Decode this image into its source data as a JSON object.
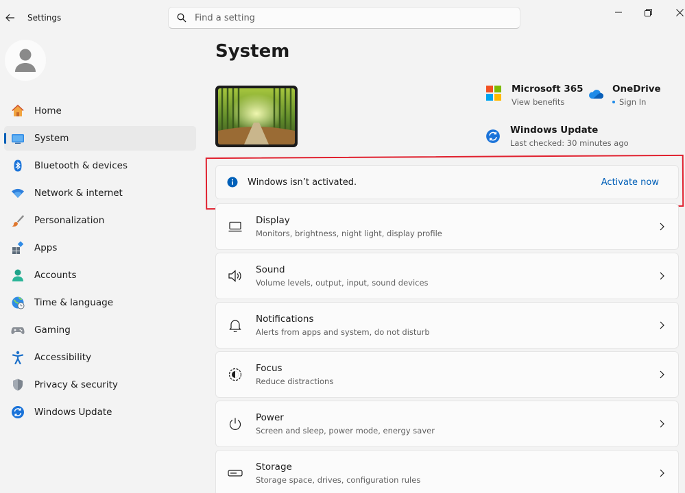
{
  "window": {
    "title": "Settings",
    "search_placeholder": "Find a setting"
  },
  "sidebar": {
    "items": [
      {
        "label": "Home",
        "icon": "home-icon",
        "selected": false
      },
      {
        "label": "System",
        "icon": "system-icon",
        "selected": true
      },
      {
        "label": "Bluetooth & devices",
        "icon": "bluetooth-icon",
        "selected": false
      },
      {
        "label": "Network & internet",
        "icon": "wifi-icon",
        "selected": false
      },
      {
        "label": "Personalization",
        "icon": "brush-icon",
        "selected": false
      },
      {
        "label": "Apps",
        "icon": "apps-icon",
        "selected": false
      },
      {
        "label": "Accounts",
        "icon": "accounts-icon",
        "selected": false
      },
      {
        "label": "Time & language",
        "icon": "globe-icon",
        "selected": false
      },
      {
        "label": "Gaming",
        "icon": "gamepad-icon",
        "selected": false
      },
      {
        "label": "Accessibility",
        "icon": "accessibility-icon",
        "selected": false
      },
      {
        "label": "Privacy & security",
        "icon": "shield-icon",
        "selected": false
      },
      {
        "label": "Windows Update",
        "icon": "update-icon",
        "selected": false
      }
    ]
  },
  "main": {
    "title": "System",
    "quick_links": {
      "m365": {
        "title": "Microsoft 365",
        "subtitle": "View benefits"
      },
      "onedrive": {
        "title": "OneDrive",
        "subtitle": "Sign In"
      },
      "windows_update": {
        "title": "Windows Update",
        "subtitle": "Last checked: 30 minutes ago"
      }
    },
    "activation": {
      "message": "Windows isn’t activated.",
      "action": "Activate now"
    },
    "cards": [
      {
        "title": "Display",
        "subtitle": "Monitors, brightness, night light, display profile",
        "icon": "display-icon"
      },
      {
        "title": "Sound",
        "subtitle": "Volume levels, output, input, sound devices",
        "icon": "speaker-icon"
      },
      {
        "title": "Notifications",
        "subtitle": "Alerts from apps and system, do not disturb",
        "icon": "bell-icon"
      },
      {
        "title": "Focus",
        "subtitle": "Reduce distractions",
        "icon": "focus-icon"
      },
      {
        "title": "Power",
        "subtitle": "Screen and sleep, power mode, energy saver",
        "icon": "power-icon"
      },
      {
        "title": "Storage",
        "subtitle": "Storage space, drives, configuration rules",
        "icon": "storage-icon"
      }
    ]
  },
  "colors": {
    "accent": "#005fb8",
    "highlight": "#e0202e",
    "background": "#f3f3f3"
  }
}
